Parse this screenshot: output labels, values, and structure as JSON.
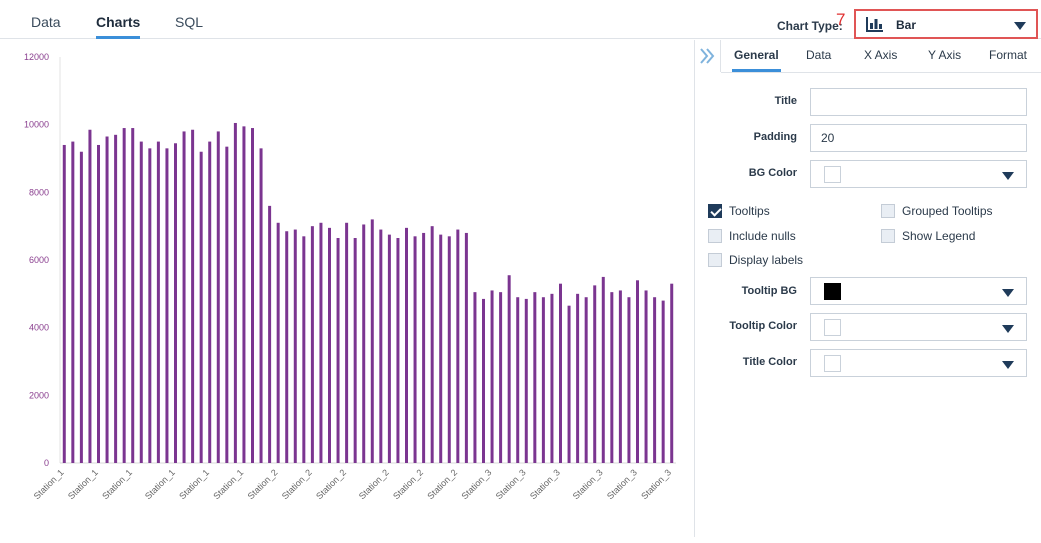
{
  "main_tabs": [
    {
      "label": "Data",
      "active": false
    },
    {
      "label": "Charts",
      "active": true
    },
    {
      "label": "SQL",
      "active": false
    }
  ],
  "chart_type": {
    "label": "Chart Type:",
    "value": "Bar",
    "icon": "bar-chart-icon",
    "annotation": "7"
  },
  "panel": {
    "tabs": [
      {
        "label": "General",
        "active": true
      },
      {
        "label": "Data",
        "active": false
      },
      {
        "label": "X Axis",
        "active": false
      },
      {
        "label": "Y Axis",
        "active": false
      },
      {
        "label": "Format",
        "active": false
      }
    ],
    "fields": {
      "title": {
        "label": "Title",
        "value": ""
      },
      "padding": {
        "label": "Padding",
        "value": "20"
      },
      "bg_color": {
        "label": "BG Color",
        "color": "#ffffff"
      },
      "tooltip_bg": {
        "label": "Tooltip BG",
        "color": "#000000"
      },
      "tooltip_color": {
        "label": "Tooltip Color",
        "color": "#ffffff"
      },
      "title_color": {
        "label": "Title Color",
        "color": "#ffffff"
      }
    },
    "checkboxes": [
      {
        "label": "Tooltips",
        "checked": true
      },
      {
        "label": "Grouped Tooltips",
        "checked": false
      },
      {
        "label": "Include nulls",
        "checked": false
      },
      {
        "label": "Show Legend",
        "checked": false
      },
      {
        "label": "Display labels",
        "checked": false
      }
    ]
  },
  "colors": {
    "bar": "#7b3590",
    "accent": "#3b8fd9",
    "highlight": "#e05555",
    "axis_text": "#8a3f8f"
  },
  "chart_data": {
    "type": "bar",
    "ylim": [
      0,
      12000
    ],
    "yticks": [
      "0",
      "2000",
      "4000",
      "6000",
      "8000",
      "10000",
      "12000"
    ],
    "x_tick_labels": [
      "Station_1",
      "Station_1",
      "Station_1",
      "Station_1",
      "Station_1",
      "Station_1",
      "Station_2",
      "Station_2",
      "Station_2",
      "Station_2",
      "Station_2",
      "Station_2",
      "Station_3",
      "Station_3",
      "Station_3",
      "Station_3",
      "Station_3",
      "Station_3"
    ],
    "values": [
      9400,
      9500,
      9200,
      9850,
      9400,
      9650,
      9700,
      9900,
      9900,
      9500,
      9300,
      9500,
      9300,
      9450,
      9800,
      9850,
      9200,
      9500,
      9800,
      9350,
      10050,
      9950,
      9900,
      9300,
      7600,
      7100,
      6850,
      6900,
      6700,
      7000,
      7100,
      6950,
      6650,
      7100,
      6650,
      7050,
      7200,
      6900,
      6750,
      6650,
      6950,
      6700,
      6800,
      7000,
      6750,
      6700,
      6900,
      6800,
      5050,
      4850,
      5100,
      5050,
      5550,
      4900,
      4850,
      5050,
      4900,
      5000,
      5300,
      4650,
      5000,
      4900,
      5250,
      5500,
      5050,
      5100,
      4900,
      5400,
      5100,
      4900,
      4800,
      5300
    ]
  }
}
